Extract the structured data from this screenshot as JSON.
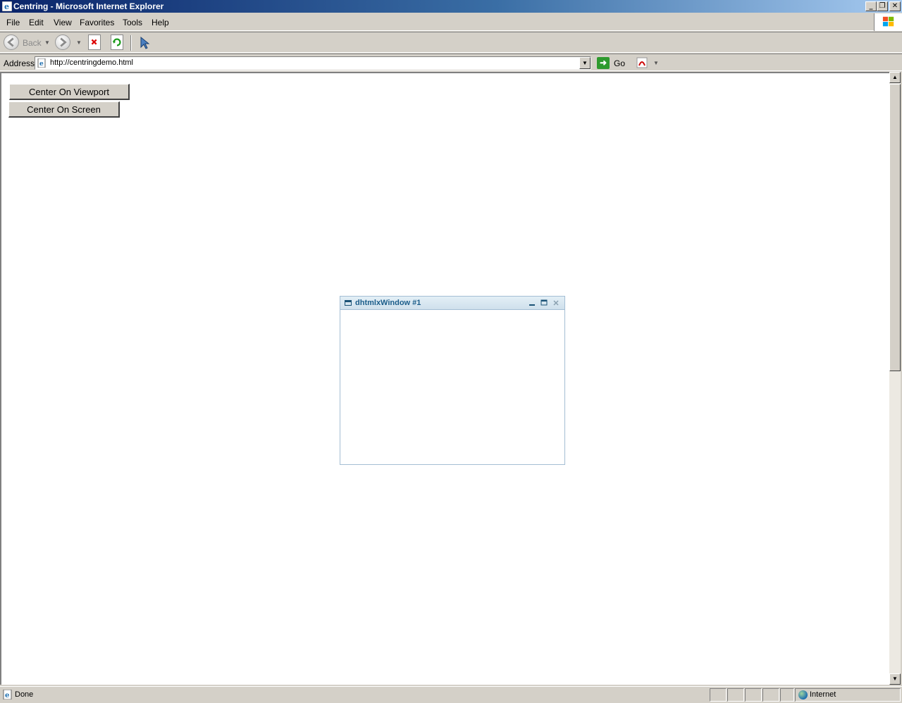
{
  "window": {
    "title": "Centring - Microsoft Internet Explorer",
    "minimize": "_",
    "restore": "❐",
    "close": "✕"
  },
  "menu": {
    "items": [
      {
        "label": "File"
      },
      {
        "label": "Edit"
      },
      {
        "label": "View"
      },
      {
        "label": "Favorites"
      },
      {
        "label": "Tools"
      },
      {
        "label": "Help"
      }
    ]
  },
  "toolbar": {
    "back_label": "Back"
  },
  "address": {
    "label": "Address",
    "url": "http://centringdemo.html",
    "go_label": "Go"
  },
  "page": {
    "buttons": {
      "center_viewport": "Center On Viewport",
      "center_screen": "Center On Screen"
    },
    "dhx_window": {
      "title": "dhtmlxWindow #1"
    }
  },
  "status": {
    "text": "Done",
    "zone": "Internet"
  },
  "colors": {
    "titlebar_start": "#0a246a",
    "dhx_title": "#1b5d8a",
    "dhx_border": "#a4bed4"
  }
}
